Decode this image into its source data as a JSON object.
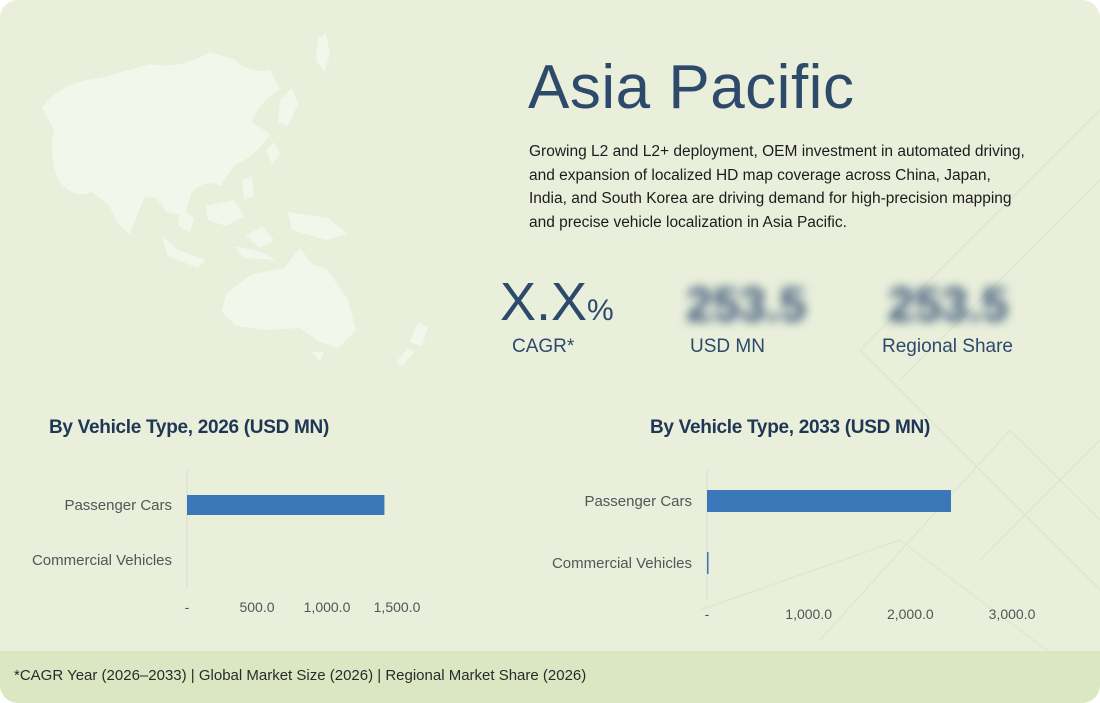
{
  "region": {
    "title": "Asia Pacific",
    "description": "Growing L2 and L2+ deployment, OEM investment in automated driving, and expansion of localized HD map coverage across China, Japan, India, and South Korea are driving demand for high-precision mapping and precise vehicle localization in Asia Pacific."
  },
  "stats": {
    "cagr": {
      "value": "X.X",
      "unit": "%",
      "label": "CAGR*"
    },
    "market_size": {
      "value": "253.5",
      "label": "USD MN"
    },
    "regional_share": {
      "value": "253.5",
      "label": "Regional Share"
    }
  },
  "footer": {
    "text": "*CAGR Year (2026–2033) | Global Market Size (2026) | Regional Market Share (2026)"
  },
  "colors": {
    "bar": "#3a77b8",
    "title": "#2d4a6b",
    "background": "#e9efdb",
    "footer": "#dbe7c3",
    "map": "#f3f6ea"
  },
  "chart_data": [
    {
      "type": "bar",
      "orientation": "horizontal",
      "title": "By Vehicle Type, 2026 (USD MN)",
      "categories": [
        "Passenger Cars",
        "Commercial Vehicles"
      ],
      "values": [
        1410,
        0
      ],
      "xlim": [
        0,
        1500
      ],
      "xticks": [
        0,
        500,
        1000,
        1500
      ],
      "xtick_labels": [
        "-",
        "500.0",
        "1,000.0",
        "1,500.0"
      ]
    },
    {
      "type": "bar",
      "orientation": "horizontal",
      "title": "By Vehicle Type, 2033 (USD MN)",
      "categories": [
        "Passenger Cars",
        "Commercial Vehicles"
      ],
      "values": [
        2400,
        15
      ],
      "xlim": [
        0,
        3000
      ],
      "xticks": [
        0,
        1000,
        2000,
        3000
      ],
      "xtick_labels": [
        "-",
        "1,000.0",
        "2,000.0",
        "3,000.0"
      ]
    }
  ]
}
